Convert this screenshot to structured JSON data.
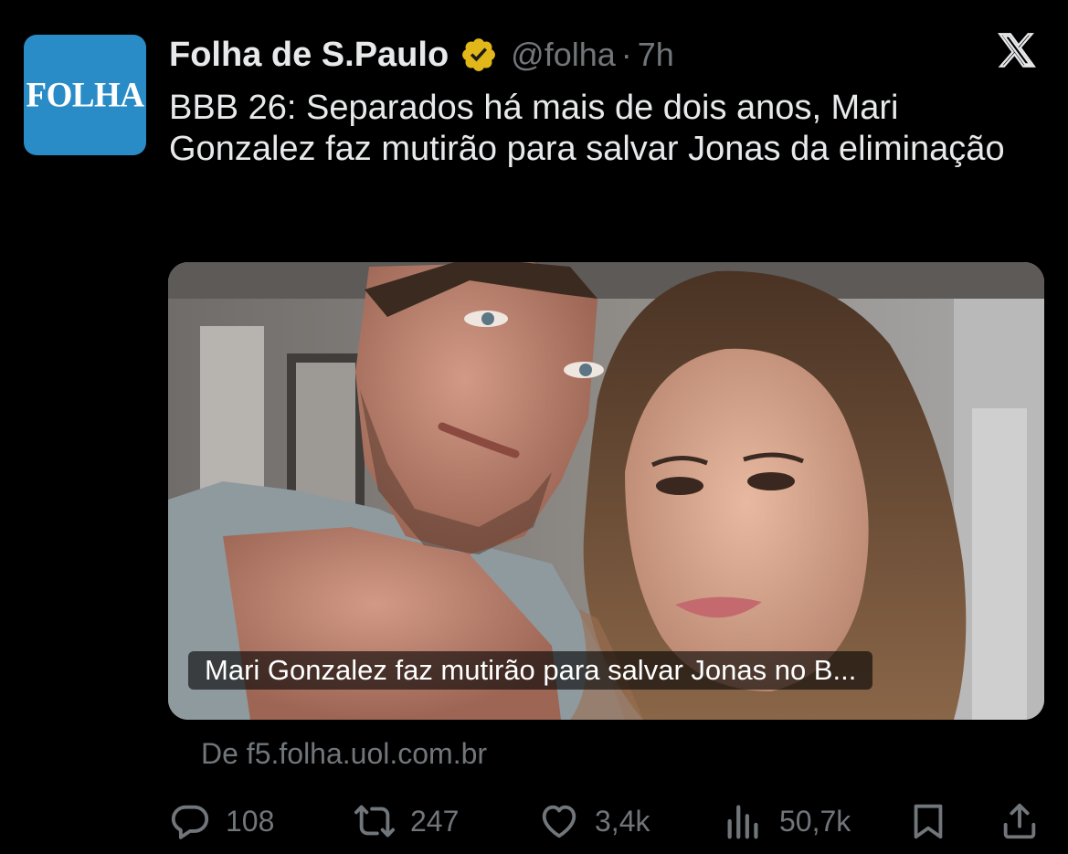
{
  "author": {
    "avatar_text": "FOLHA",
    "name": "Folha de S.Paulo",
    "handle": "@folha",
    "separator": "·",
    "time": "7h"
  },
  "tweet": {
    "text": "BBB 26: Separados há mais de dois anos, Mari Gonzalez faz mutirão para salvar Jonas da eliminação"
  },
  "card": {
    "caption": "Mari Gonzalez faz mutirão para salvar Jonas no B...",
    "source": "De f5.folha.uol.com.br"
  },
  "actions": {
    "replies": "108",
    "reposts": "247",
    "likes": "3,4k",
    "views": "50,7k"
  },
  "icons": [
    "verified-badge-icon",
    "x-logo-icon",
    "reply-icon",
    "repost-icon",
    "like-icon",
    "views-icon",
    "bookmark-icon",
    "share-icon"
  ],
  "colors": {
    "background": "#000000",
    "text": "#e7e9ea",
    "muted": "#71767b",
    "verified_gold": "#e2b719",
    "avatar_blue": "#2a8cc6"
  }
}
